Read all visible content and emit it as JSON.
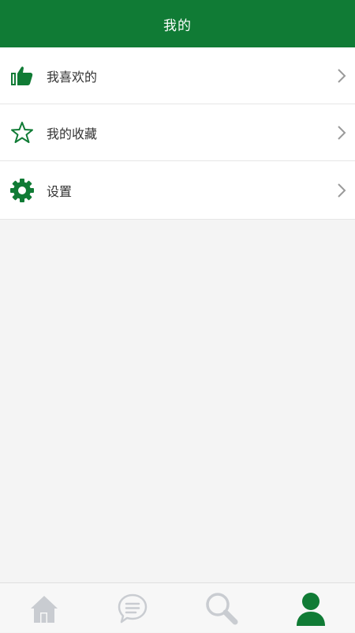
{
  "header": {
    "title": "我的"
  },
  "menu": {
    "items": [
      {
        "label": "我喜欢的",
        "icon": "thumbs-up-icon"
      },
      {
        "label": "我的收藏",
        "icon": "star-icon"
      },
      {
        "label": "设置",
        "icon": "gear-icon"
      }
    ]
  },
  "tabbar": {
    "tabs": [
      {
        "icon": "home-icon",
        "active": false
      },
      {
        "icon": "chat-bubble-icon",
        "active": false
      },
      {
        "icon": "search-icon",
        "active": false
      },
      {
        "icon": "user-icon",
        "active": true
      }
    ]
  },
  "colors": {
    "brand_green": "#107b35",
    "inactive_gray": "#c9ccd1",
    "background": "#f4f4f4"
  }
}
